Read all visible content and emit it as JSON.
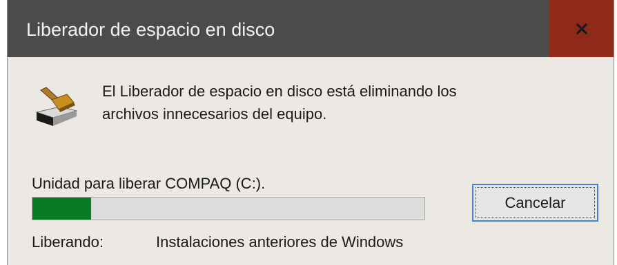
{
  "window": {
    "title": "Liberador de espacio en disco",
    "close_icon": "close-icon"
  },
  "message": {
    "line1": "El Liberador de espacio en disco está eliminando los",
    "line2": "archivos innecesarios del equipo."
  },
  "drive": {
    "label": "Unidad para liberar COMPAQ (C:)."
  },
  "progress": {
    "fraction": 0.15,
    "fill_color": "#0a7a27"
  },
  "buttons": {
    "cancel_label": "Cancelar"
  },
  "status": {
    "label": "Liberando:",
    "value": "Instalaciones anteriores de Windows"
  },
  "colors": {
    "titlebar": "#4b4c4a",
    "close_button": "#8f2a1b",
    "dialog_background": "#ece8e4"
  }
}
